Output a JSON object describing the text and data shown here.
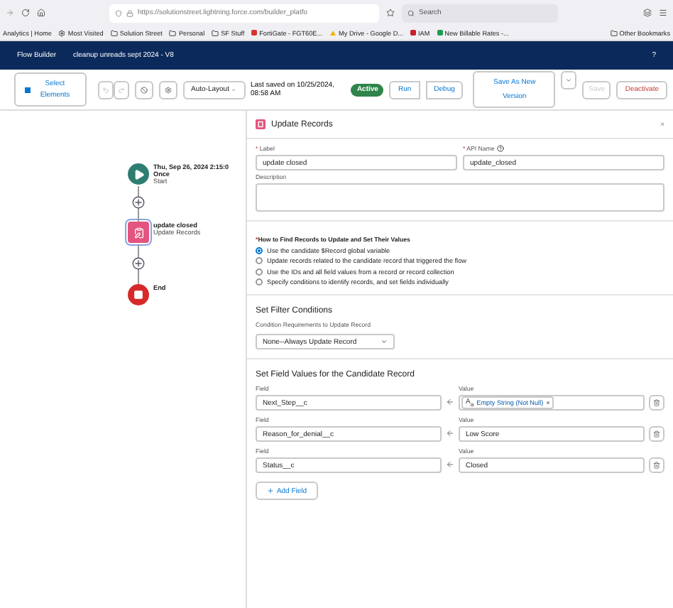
{
  "browser": {
    "url": "https://solutionstreet.lightning.force.com/builder_platfo",
    "search_placeholder": "Search"
  },
  "bookmarks": [
    {
      "label": "Analytics | Home",
      "kind": "text"
    },
    {
      "label": "Most Visited",
      "kind": "gear"
    },
    {
      "label": "Solution Street",
      "kind": "folder"
    },
    {
      "label": "Personal",
      "kind": "folder"
    },
    {
      "label": "SF Stuff",
      "kind": "folder"
    },
    {
      "label": "FortiGate - FGT60E...",
      "kind": "site",
      "color": "#d9352c"
    },
    {
      "label": "My Drive - Google D...",
      "kind": "drive"
    },
    {
      "label": "IAM",
      "kind": "site",
      "color": "#c8202f"
    },
    {
      "label": "New Billable Rates -...",
      "kind": "site",
      "color": "#1e9d4f"
    }
  ],
  "other_bookmarks": "Other Bookmarks",
  "app_header": {
    "app_name": "Flow Builder",
    "flow_name": "cleanup unreads sept 2024 - V8",
    "help": "?"
  },
  "toolbar": {
    "select_elements": "Select Elements",
    "layout": "Auto-Layout",
    "saved": "Last saved on 10/25/2024, 08:58 AM",
    "status": "Active",
    "run": "Run",
    "debug": "Debug",
    "save_as": "Save As New Version",
    "save": {
      "label": "Save",
      "disabled": true
    },
    "deactivate": "Deactivate"
  },
  "canvas": {
    "nodes": [
      {
        "kind": "start",
        "title_lines": [
          "Thu, Sep 26, 2024 2:15:0",
          "Once"
        ],
        "subtitle": "Start",
        "selected": false
      },
      {
        "kind": "update",
        "title_lines": [
          "update closed"
        ],
        "subtitle": "Update Records",
        "selected": true
      },
      {
        "kind": "end",
        "title_lines": [
          "End"
        ],
        "selected": false
      }
    ]
  },
  "panel": {
    "title": "Update Records",
    "close": "×",
    "label_field": {
      "mark": "*",
      "label": "Label",
      "value": "update closed"
    },
    "api_field": {
      "mark": "*",
      "label": "API Name",
      "value": "update_closed"
    },
    "description": {
      "label": "Description"
    },
    "find_records": {
      "mark": "*",
      "label": "How to Find Records to Update and Set Their Values",
      "options": [
        {
          "label": "Use the candidate $Record global variable",
          "selected": true
        },
        {
          "label": "Update records related to the candidate record that triggered the flow",
          "selected": false
        },
        {
          "label": "Use the IDs and all field values from a record or record collection",
          "selected": false
        },
        {
          "label": "Specify conditions to identify records, and set fields individually",
          "selected": false
        }
      ]
    },
    "filter": {
      "heading": "Set Filter Conditions",
      "condition_label": "Condition Requirements to Update Record",
      "condition_value": "None--Always Update Record"
    },
    "field_values": {
      "heading": "Set Field Values for the Candidate Record",
      "rows": [
        {
          "field_label": "Field",
          "field": "Next_Step__c",
          "value_label": "Value",
          "kind": "pill",
          "type_label": "A$_{a}$",
          "value": "Empty String (Not Null)",
          "remove": "×"
        },
        {
          "field_label": "Field",
          "field": "Reason_for_denial__c",
          "value_label": "Value",
          "kind": "text",
          "value": "Low Score"
        },
        {
          "field_label": "Field",
          "field": "Status__c",
          "value_label": "Value",
          "kind": "text",
          "value": "Closed"
        }
      ],
      "add_button": "Add Field"
    }
  }
}
